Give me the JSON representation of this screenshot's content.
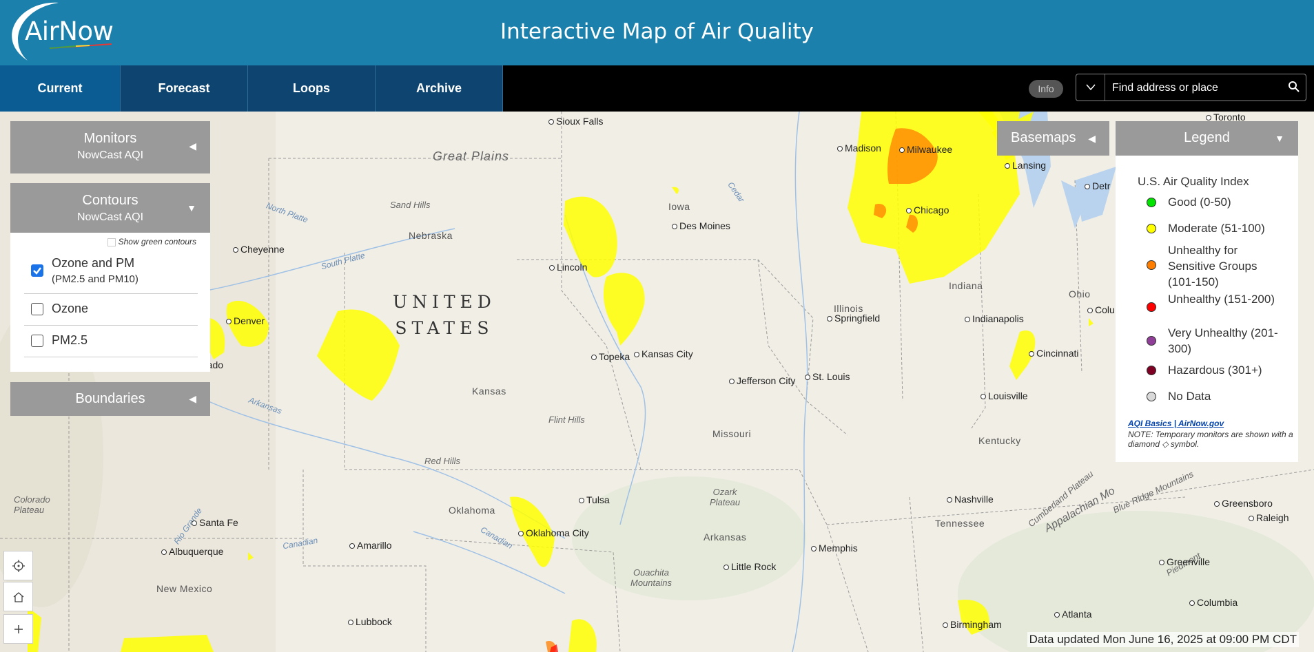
{
  "header": {
    "logo_text": "AirNow",
    "title": "Interactive Map of Air Quality"
  },
  "nav": {
    "tabs": [
      "Current",
      "Forecast",
      "Loops",
      "Archive"
    ],
    "active": "Current"
  },
  "toolbar": {
    "info_label": "Info",
    "search_placeholder": "Find address or place"
  },
  "panels": {
    "monitors": {
      "title": "Monitors",
      "subtitle": "NowCast AQI"
    },
    "contours": {
      "title": "Contours",
      "subtitle": "NowCast AQI",
      "show_green_label": "Show green contours",
      "options": [
        {
          "label": "Ozone and PM",
          "sublabel": "(PM2.5 and PM10)",
          "checked": true
        },
        {
          "label": "Ozone",
          "checked": false
        },
        {
          "label": "PM2.5",
          "checked": false
        }
      ]
    },
    "boundaries": {
      "title": "Boundaries"
    },
    "basemaps": {
      "title": "Basemaps"
    }
  },
  "legend": {
    "header": "Legend",
    "title": "U.S. Air Quality Index",
    "items": [
      {
        "label": "Good (0-50)",
        "color": "#00e400"
      },
      {
        "label": "Moderate (51-100)",
        "color": "#ffff00"
      },
      {
        "label": "Unhealthy for Sensitive Groups (101-150)",
        "color": "#ff7e00"
      },
      {
        "label": "Unhealthy (151-200)",
        "color": "#ff0000"
      },
      {
        "label": "Very Unhealthy (201-300)",
        "color": "#8f3f97"
      },
      {
        "label": "Hazardous (301+)",
        "color": "#7e0023"
      },
      {
        "label": "No Data",
        "color": "#d9d9d9"
      }
    ],
    "link_text": "AQI Basics | AirNow.gov",
    "note": "NOTE: Temporary monitors are shown with a diamond ◇ symbol."
  },
  "map": {
    "country_line1": "UNITED",
    "country_line2": "STATES",
    "cities": {
      "sioux_falls": "Sioux Falls",
      "madison": "Madison",
      "milwaukee": "Milwaukee",
      "lansing": "Lansing",
      "detroit": "Detr",
      "toronto": "Toronto",
      "chicago": "Chicago",
      "des_moines": "Des Moines",
      "cheyenne": "Cheyenne",
      "lincoln": "Lincoln",
      "denver": "Denver",
      "colorado_springs": "rado",
      "topeka": "Topeka",
      "kansas_city": "Kansas City",
      "springfield": "Springfield",
      "indianapolis": "Indianapolis",
      "columbus": "Colu",
      "cincinnati": "Cincinnati",
      "jefferson_city": "Jefferson City",
      "st_louis": "St. Louis",
      "louisville": "Louisville",
      "tulsa": "Tulsa",
      "oklahoma_city": "Oklahoma City",
      "santa_fe": "Santa Fe",
      "albuquerque": "Albuquerque",
      "amarillo": "Amarillo",
      "nashville": "Nashville",
      "memphis": "Memphis",
      "little_rock": "Little Rock",
      "greensboro": "Greensboro",
      "raleigh": "Raleigh",
      "greenville": "Greenville",
      "columbia": "Columbia",
      "atlanta": "Atlanta",
      "birmingham": "Birmingham",
      "lubbock": "Lubbock"
    },
    "states": {
      "iowa": "Iowa",
      "nebraska": "Nebraska",
      "illinois": "Illinois",
      "indiana": "Indiana",
      "ohio": "Ohio",
      "kansas": "Kansas",
      "missouri": "Missouri",
      "kentucky": "Kentucky",
      "tennessee": "Tennessee",
      "oklahoma": "Oklahoma",
      "arkansas": "Arkansas",
      "new_mexico": "New Mexico"
    },
    "regions": {
      "great_plains": "Great Plains",
      "sand_hills": "Sand Hills",
      "flint_hills": "Flint Hills",
      "red_hills": "Red Hills",
      "ozark_plateau": "Ozark Plateau",
      "ouachita": "Ouachita Mountains",
      "colorado_plateau": "Colorado Plateau",
      "appalachian": "Appalachian Mo",
      "cumberland": "Cumberland Plateau",
      "blue_ridge": "Blue Ridge Mountains",
      "piedmont": "Piedmont"
    },
    "waters": {
      "north_platte": "North Platte",
      "south_platte": "South Platte",
      "arkansas_river": "Arkansas",
      "canadian": "Canadian",
      "canadian2": "Canadian",
      "rio_grande": "Rio Grande",
      "cedar": "Cedar"
    }
  },
  "status": {
    "text": "Data updated Mon June 16, 2025 at 09:00 PM CDT"
  }
}
